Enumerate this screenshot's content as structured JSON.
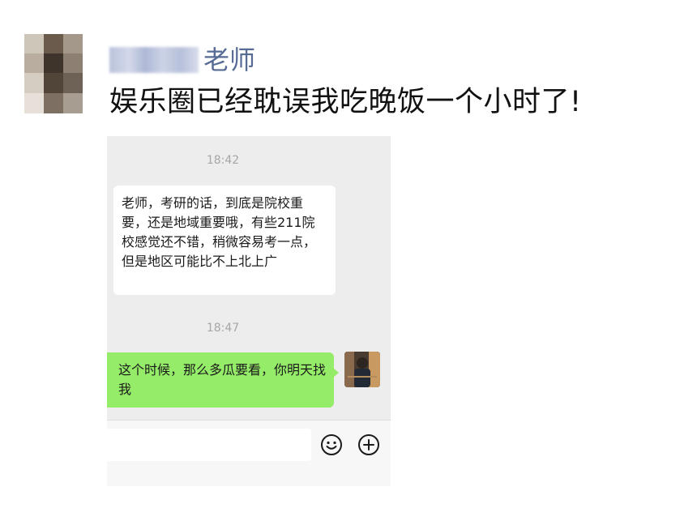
{
  "post": {
    "author_suffix": "老师",
    "text": "娱乐圈已经耽误我吃晚饭一个小时了!"
  },
  "chat": {
    "time_1": "18:42",
    "incoming_message": "老师，考研的话，到底是院校重要，还是地域重要哦，有些211院校感觉还不错，稍微容易考一点，但是地区可能比不上北上广",
    "time_2": "18:47",
    "outgoing_message": "这个时候，那么多瓜要看，你明天找我"
  },
  "colors": {
    "author_name": "#576b95",
    "chat_background": "#ededed",
    "outgoing_bubble": "#95ec69",
    "incoming_bubble": "#ffffff"
  },
  "icons": {
    "emoji": "smiley-face-icon",
    "plus": "plus-circle-icon"
  }
}
